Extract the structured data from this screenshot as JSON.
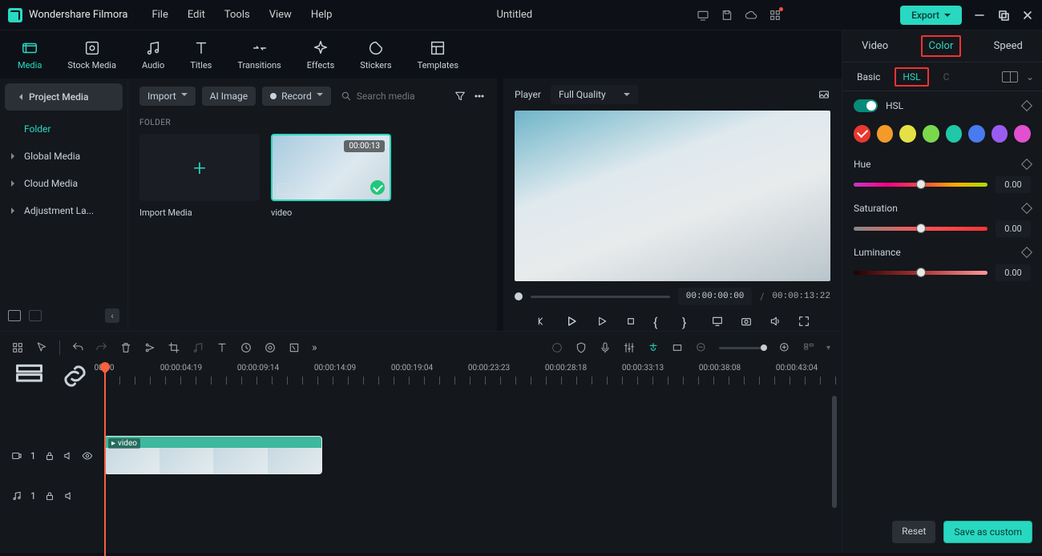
{
  "titlebar": {
    "app_name": "Wondershare Filmora",
    "menu": [
      "File",
      "Edit",
      "Tools",
      "View",
      "Help"
    ],
    "doc_title": "Untitled",
    "export": "Export"
  },
  "ribbon": [
    {
      "label": "Media",
      "active": true
    },
    {
      "label": "Stock Media"
    },
    {
      "label": "Audio"
    },
    {
      "label": "Titles"
    },
    {
      "label": "Transitions"
    },
    {
      "label": "Effects"
    },
    {
      "label": "Stickers"
    },
    {
      "label": "Templates"
    }
  ],
  "sidebar_left": {
    "project_media": "Project Media",
    "folder": "Folder",
    "items": [
      "Global Media",
      "Cloud Media",
      "Adjustment La..."
    ]
  },
  "media_panel": {
    "import": "Import",
    "ai_image": "AI Image",
    "record": "Record",
    "search_placeholder": "Search media",
    "folder_label": "FOLDER",
    "import_media": "Import Media",
    "clip_duration": "00:00:13",
    "clip_name": "video"
  },
  "preview": {
    "player": "Player",
    "quality": "Full Quality",
    "current_time": "00:00:00:00",
    "total_time": "00:00:13:22"
  },
  "right": {
    "tabs": [
      "Video",
      "Color",
      "Speed"
    ],
    "subtabs": {
      "basic": "Basic",
      "hsl": "HSL",
      "c": "C"
    },
    "hsl_label": "HSL",
    "swatches": [
      "#e8392f",
      "#f39a2b",
      "#e5e043",
      "#79d84c",
      "#1fc8a8",
      "#4a7af0",
      "#9a5cf0",
      "#e24fd0"
    ],
    "sliders": [
      {
        "name": "Hue",
        "value": "0.00"
      },
      {
        "name": "Saturation",
        "value": "0.00"
      },
      {
        "name": "Luminance",
        "value": "0.00"
      }
    ],
    "reset": "Reset",
    "save": "Save as custom"
  },
  "timeline": {
    "ruler": [
      "00:00",
      "00:00:04:19",
      "00:00:09:14",
      "00:00:14:09",
      "00:00:19:04",
      "00:00:23:23",
      "00:00:28:18",
      "00:00:33:13",
      "00:00:38:08",
      "00:00:43:04"
    ],
    "clip_label": "video",
    "video_track_index": "1",
    "audio_track_index": "1"
  }
}
